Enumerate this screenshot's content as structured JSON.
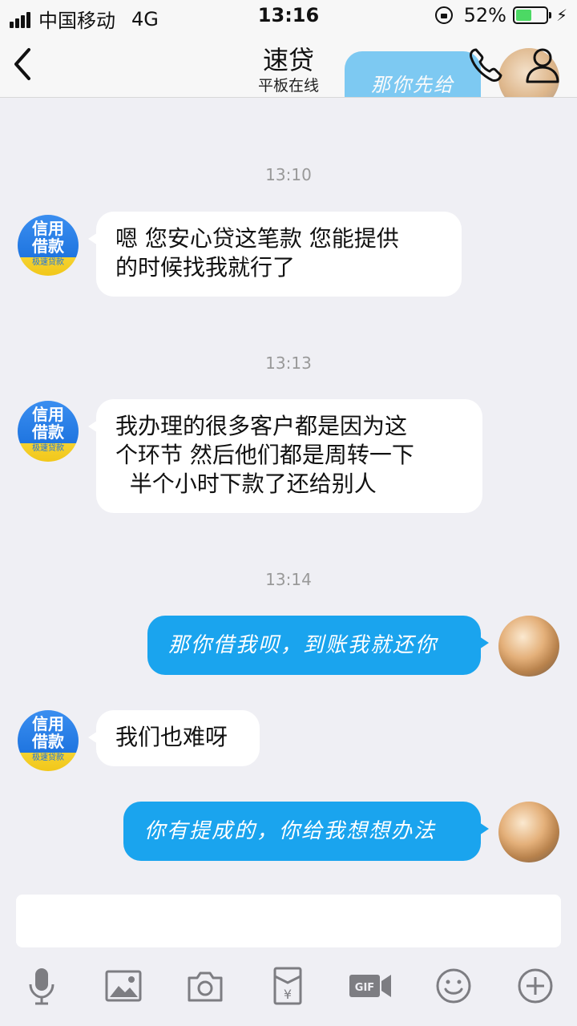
{
  "status_bar": {
    "carrier": "中国移动",
    "network": "4G",
    "time": "13:16",
    "battery": "52%",
    "battery_level": 0.52
  },
  "nav": {
    "title": "速贷",
    "subtitle": "平板在线",
    "ghost_text": "那你先给"
  },
  "contact_avatar": {
    "line1": "信用",
    "line2": "借款",
    "line3": "极速贷款"
  },
  "messages": [
    {
      "type": "time",
      "text": "13:10"
    },
    {
      "type": "in",
      "lines": [
        "嗯  您安心贷这笔款  您能提供",
        "的时候找我就行了"
      ]
    },
    {
      "type": "time",
      "text": "13:13"
    },
    {
      "type": "in",
      "lines": [
        "我办理的很多客户都是因为这",
        "个环节  然后他们都是周转一下",
        "  半个小时下款了还给别人"
      ]
    },
    {
      "type": "time",
      "text": "13:14"
    },
    {
      "type": "out",
      "text": "那你借我呗，到账我就还你"
    },
    {
      "type": "in",
      "lines": [
        "我们也难呀"
      ]
    },
    {
      "type": "out",
      "text": "你有提成的，你给我想想办法"
    }
  ],
  "input": {
    "placeholder": ""
  },
  "toolbar": [
    "mic-icon",
    "image-icon",
    "camera-icon",
    "red-packet-icon",
    "gif-icon",
    "emoji-icon",
    "plus-icon"
  ],
  "colors": {
    "accent": "#1aa4ee",
    "background": "#efeff4",
    "bubble_in": "#ffffff"
  }
}
